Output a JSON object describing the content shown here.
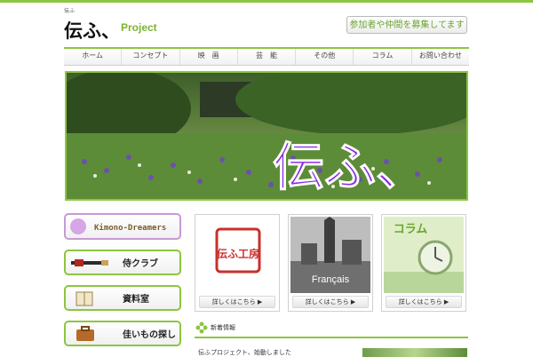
{
  "header": {
    "site_tag": "伝ふ",
    "logo_mark": "伝ふ、",
    "logo_suffix": "Project",
    "recruit_label": "参加者や仲間を募集してます"
  },
  "nav": {
    "items": [
      "ホーム",
      "コンセプト",
      "映　画",
      "芸　能",
      "その他",
      "コラム",
      "お問い合わせ"
    ]
  },
  "hero": {
    "overlay_text": "伝ふ、"
  },
  "sidebar": {
    "kimono_banner": "Kimono-Dreamers",
    "buttons": [
      {
        "label": "侍クラブ",
        "icon": "sword-icon"
      },
      {
        "label": "資料室",
        "icon": "book-icon"
      },
      {
        "label": "佳いもの探し",
        "icon": "suitcase-icon"
      }
    ]
  },
  "cards": [
    {
      "image_text": "伝ふ工房",
      "link": "詳しくはこちら ▶"
    },
    {
      "image_text": "Français",
      "link": "詳しくはこちら ▶"
    },
    {
      "image_text": "コラム",
      "link": "詳しくはこちら ▶"
    }
  ],
  "news": {
    "section_title": "新着情報",
    "first_item": "伝ふプロジェクト、始動しました"
  },
  "colors": {
    "accent": "#8cc63f",
    "accent_text": "#6aa62e",
    "hero_text": "#8a2be2"
  }
}
